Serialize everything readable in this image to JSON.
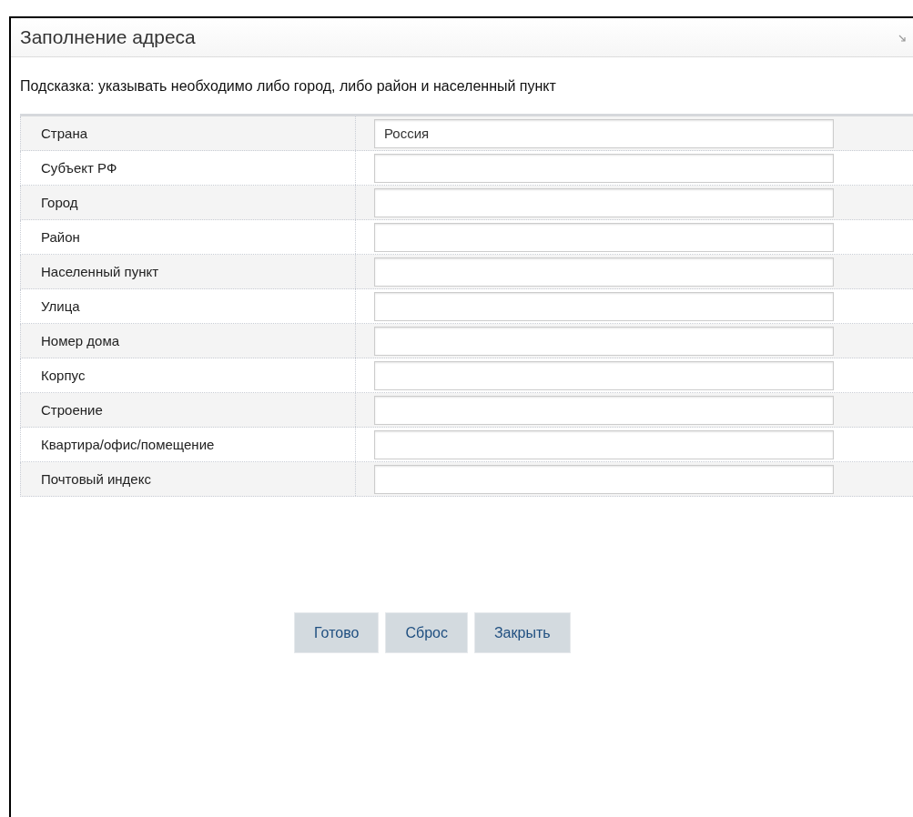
{
  "dialog": {
    "title": "Заполнение адреса",
    "hint": "Подсказка: указывать необходимо либо город, либо район и населенный пункт"
  },
  "fields": [
    {
      "label": "Страна",
      "value": "Россия"
    },
    {
      "label": "Субъект РФ"
    },
    {
      "label": "Город"
    },
    {
      "label": "Район"
    },
    {
      "label": "Населенный пункт"
    },
    {
      "label": "Улица"
    },
    {
      "label": "Номер дома"
    },
    {
      "label": "Корпус"
    },
    {
      "label": "Строение"
    },
    {
      "label": "Квартира/офис/помещение"
    },
    {
      "label": "Почтовый индекс"
    }
  ],
  "buttons": [
    "Готово",
    "Сброс",
    "Закрыть"
  ]
}
